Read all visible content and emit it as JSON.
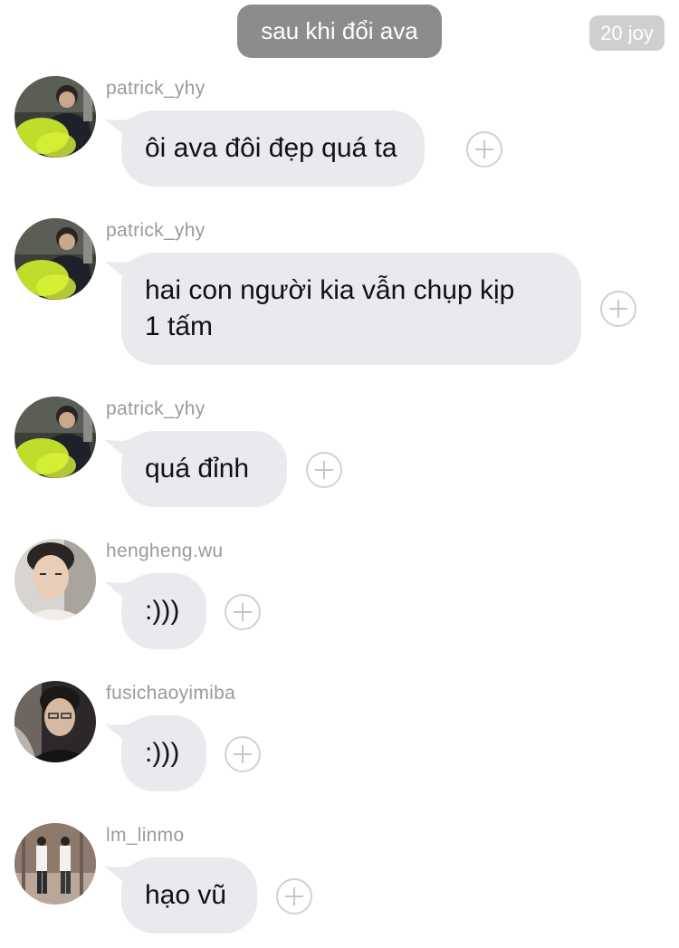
{
  "header": {
    "title_pill": "sau khi đổi ava",
    "counter_pill": "20 joy"
  },
  "messages": [
    {
      "username": "patrick_yhy",
      "text": "ôi ava đôi đẹp quá ta",
      "avatar": "patrick-avatar"
    },
    {
      "username": "patrick_yhy",
      "text_line1": "hai con người kia vẫn chụp kịp",
      "text_line2": "1 tấm",
      "avatar": "patrick-avatar"
    },
    {
      "username": "patrick_yhy",
      "text": "quá đỉnh",
      "avatar": "patrick-avatar"
    },
    {
      "username": "hengheng.wu",
      "text": ":)))",
      "avatar": "hengheng-avatar"
    },
    {
      "username": "fusichaoyimiba",
      "text": ":)))",
      "avatar": "fusichao-avatar"
    },
    {
      "username": "lm_linmo",
      "text": "hạo vũ",
      "avatar": "linmo-avatar"
    }
  ],
  "colors": {
    "bubble": "#e8eaed",
    "title_pill": "#8c8c8c",
    "counter_pill": "#cfcfcf",
    "username": "#9a9a9a"
  }
}
